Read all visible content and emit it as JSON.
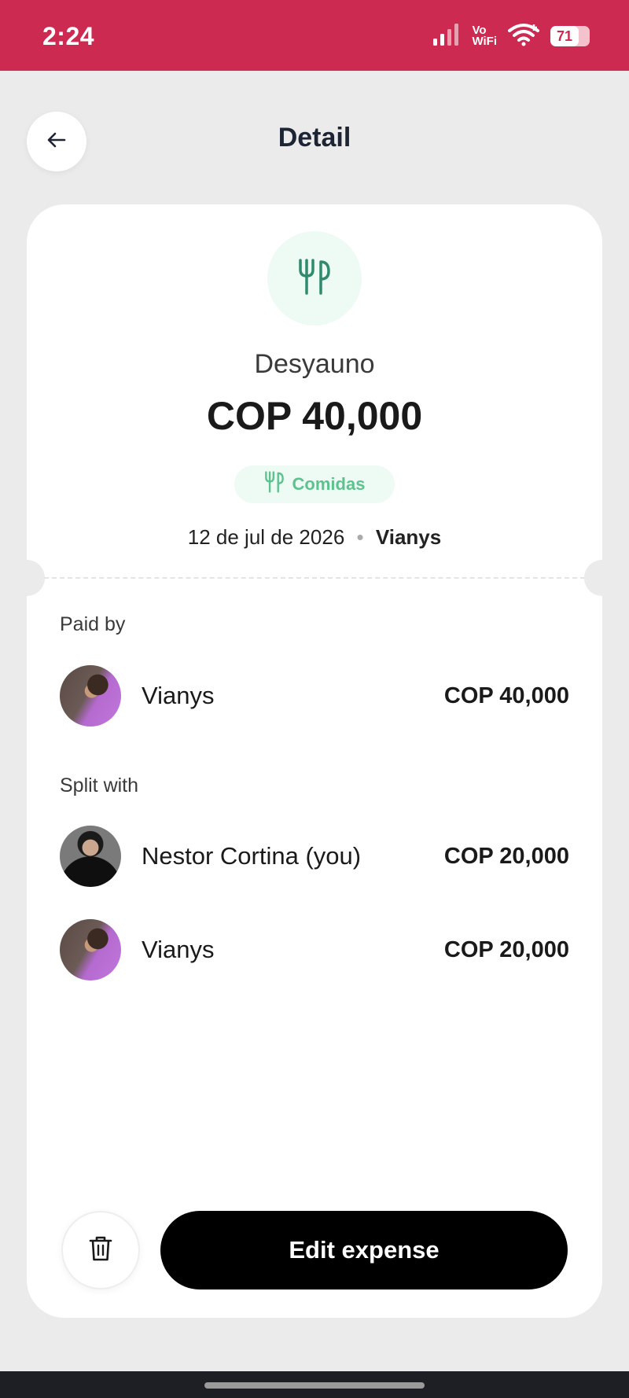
{
  "status_bar": {
    "time": "2:24",
    "vo_label": "Vo",
    "wifi_label": "WiFi",
    "battery": "71"
  },
  "header": {
    "title": "Detail",
    "back_icon": "arrow-left-icon"
  },
  "expense": {
    "category_icon": "fork-knife-icon",
    "name": "Desyauno",
    "amount": "COP 40,000",
    "category": "Comidas",
    "date": "12 de jul de 2026",
    "separator": "•",
    "created_by": "Vianys"
  },
  "paid_by": {
    "label": "Paid by",
    "items": [
      {
        "name": "Vianys",
        "amount": "COP 40,000"
      }
    ]
  },
  "split_with": {
    "label": "Split with",
    "items": [
      {
        "name": "Nestor Cortina (you)",
        "amount": "COP 20,000"
      },
      {
        "name": "Vianys",
        "amount": "COP 20,000"
      }
    ]
  },
  "actions": {
    "delete_icon": "trash-icon",
    "edit_label": "Edit expense"
  },
  "colors": {
    "status_bar": "#cc2a50",
    "accent_green": "#5ec28f",
    "category_bg": "#eefaf4",
    "primary_button": "#000000"
  }
}
